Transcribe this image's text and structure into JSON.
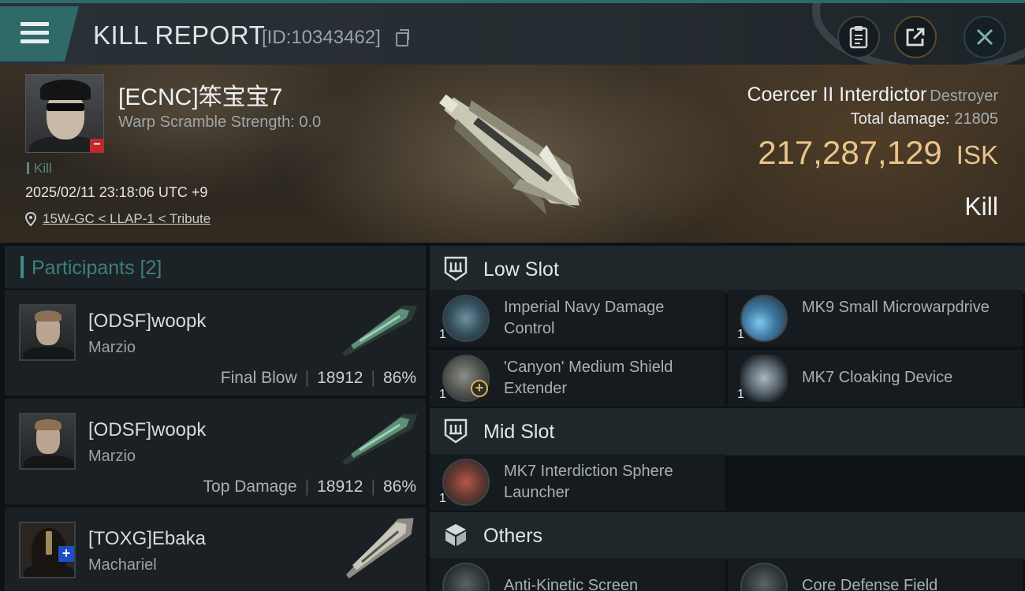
{
  "header": {
    "title": "KILL REPORT",
    "report_id": "[ID:10343462]"
  },
  "victim": {
    "name": "[ECNC]笨宝宝7",
    "warp_scramble": "Warp Scramble Strength: 0.0",
    "tag": "Kill",
    "datetime": "2025/02/11 23:18:06 UTC +9",
    "location": "15W-GC < LLAP-1 < Tribute",
    "ship": "Coercer II Interdictor",
    "ship_class": "Destroyer",
    "total_damage_label": "Total damage:",
    "total_damage": "21805",
    "isk_value": "217,287,129",
    "isk_unit": "ISK",
    "result": "Kill"
  },
  "participants": {
    "title": "Participants [2]",
    "rows": [
      {
        "name": "[ODSF]woopk",
        "ship": "Marzio",
        "label": "Final Blow",
        "damage": "18912",
        "percent": "86%"
      },
      {
        "name": "[ODSF]woopk",
        "ship": "Marzio",
        "label": "Top Damage",
        "damage": "18912",
        "percent": "86%"
      },
      {
        "name": "[TOXG]Ebaka",
        "ship": "Machariel"
      }
    ]
  },
  "fitting": {
    "low_slot": {
      "title": "Low Slot",
      "items": [
        {
          "name": "Imperial Navy Damage Control",
          "qty": "1"
        },
        {
          "name": "MK9 Small Microwarpdrive",
          "qty": "1"
        },
        {
          "name": "'Canyon' Medium Shield Extender",
          "qty": "1"
        },
        {
          "name": "MK7 Cloaking Device",
          "qty": "1"
        }
      ]
    },
    "mid_slot": {
      "title": "Mid Slot",
      "items": [
        {
          "name": "MK7 Interdiction Sphere Launcher",
          "qty": "1"
        }
      ]
    },
    "others": {
      "title": "Others",
      "items": [
        {
          "name": "Anti-Kinetic Screen"
        },
        {
          "name": "Core Defense Field"
        }
      ]
    }
  },
  "icons": {
    "menu": "hamburger-icon",
    "copy": "copy-icon",
    "clipboard": "clipboard-icon",
    "export": "export-icon",
    "close": "close-icon",
    "location": "location-pin-icon",
    "low_slot": "low-slot-icon",
    "mid_slot": "mid-slot-icon",
    "others": "cube-icon"
  },
  "colors": {
    "accent_teal": "#2f6a69",
    "isk_gold": "#e9c48a",
    "minus_red": "#c1272d",
    "plus_blue": "#1d4ec6"
  }
}
